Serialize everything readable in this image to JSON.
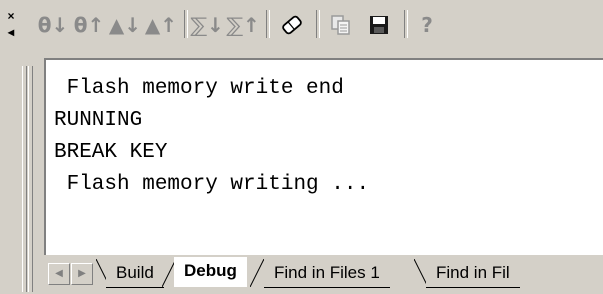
{
  "dock": {
    "close_glyph": "×",
    "pin_glyph": "◂"
  },
  "toolbar": {
    "icons": [
      {
        "name": "prev-error-icon",
        "glyph": "θ↓"
      },
      {
        "name": "next-error-icon",
        "glyph": "θ↑"
      },
      {
        "name": "prev-warning-icon",
        "glyph": "▲↓"
      },
      {
        "name": "next-warning-icon",
        "glyph": "▲↑"
      },
      {
        "name": "sort-asc-icon",
        "glyph": "⅀↓"
      },
      {
        "name": "sort-desc-icon",
        "glyph": "⅀↑"
      },
      {
        "name": "clear-icon",
        "glyph": "⌫"
      },
      {
        "name": "copy-icon",
        "glyph": "⎘"
      },
      {
        "name": "save-icon",
        "glyph": "■"
      },
      {
        "name": "help-icon",
        "glyph": "?"
      }
    ]
  },
  "output": {
    "lines": [
      " Flash memory write end",
      "RUNNING",
      "BREAK KEY",
      " Flash memory writing ..."
    ]
  },
  "tabs": {
    "items": [
      {
        "label": "Build",
        "active": false
      },
      {
        "label": "Debug",
        "active": true
      },
      {
        "label": "Find in Files 1",
        "active": false
      },
      {
        "label": "Find in Fil",
        "active": false
      }
    ],
    "scroll_left_glyph": "◀",
    "scroll_right_glyph": "▶"
  },
  "colors": {
    "chrome": "#d4d0c8",
    "panel": "#ffffff",
    "disabled_icon": "#8a8a8a",
    "save_icon": "#1a1a1a"
  }
}
